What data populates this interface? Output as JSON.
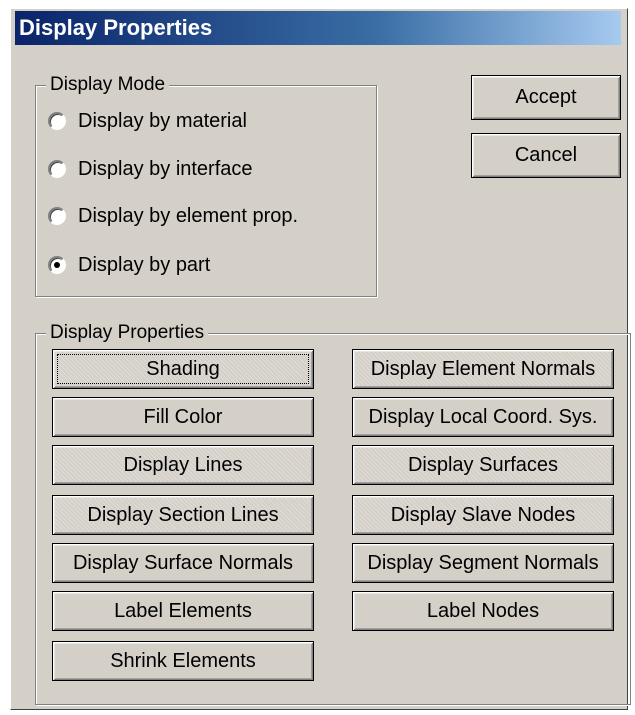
{
  "window": {
    "title": "Display Properties"
  },
  "display_mode": {
    "label": "Display Mode",
    "options": [
      {
        "label": "Display by material",
        "checked": false
      },
      {
        "label": "Display by interface",
        "checked": false
      },
      {
        "label": "Display by element prop.",
        "checked": false
      },
      {
        "label": "Display by part",
        "checked": true
      }
    ]
  },
  "dialog_buttons": {
    "accept": "Accept",
    "cancel": "Cancel"
  },
  "display_properties": {
    "label": "Display Properties",
    "left_buttons": [
      "Shading",
      "Fill Color",
      "Display Lines",
      "Display Section Lines",
      "Display Surface Normals",
      "Label Elements",
      "Shrink Elements"
    ],
    "right_buttons": [
      "Display Element Normals",
      "Display Local Coord. Sys.",
      "Display Surfaces",
      "Display Slave Nodes",
      "Display Segment Normals",
      "Label Nodes"
    ]
  }
}
